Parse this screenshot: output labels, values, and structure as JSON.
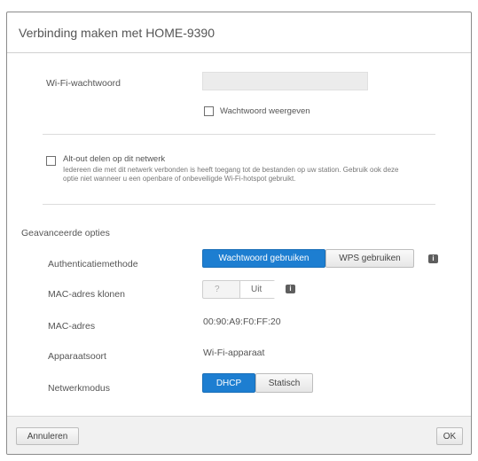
{
  "dialog": {
    "title": "Verbinding maken met HOME-9390"
  },
  "wifi_password": {
    "label": "Wi-Fi-wachtwoord",
    "value": "",
    "show_password_label": "Wachtwoord weergeven",
    "show_password_checked": false
  },
  "share": {
    "checkbox_label": "Alt-out delen op dit netwerk",
    "checked": false,
    "description": "Iedereen die met dit netwerk verbonden is heeft toegang tot de bestanden op uw station. Gebruik ook deze optie niet wanneer u een openbare of onbeveiligde Wi-Fi-hotspot gebruikt."
  },
  "advanced": {
    "section_title": "Geavanceerde opties",
    "auth_method": {
      "label": "Authenticatiemethode",
      "options": [
        "Wachtwoord gebruiken",
        "WPS gebruiken"
      ],
      "selected": "Wachtwoord gebruiken"
    },
    "mac_clone": {
      "label": "MAC-adres klonen",
      "off_label": "?",
      "on_label": "Uit"
    },
    "mac_address": {
      "label": "MAC-adres",
      "value": "00:90:A9:F0:FF:20"
    },
    "access_type": {
      "label": "Apparaatsoort",
      "value": "Wi-Fi-apparaat"
    },
    "network_mode": {
      "label": "Netwerkmodus",
      "options": [
        "DHCP",
        "Statisch"
      ],
      "selected": "DHCP"
    }
  },
  "footer": {
    "cancel_label": "Annuleren",
    "ok_label": "OK"
  },
  "colors": {
    "primary": "#1d7ed1",
    "border": "#8c8c8c"
  }
}
